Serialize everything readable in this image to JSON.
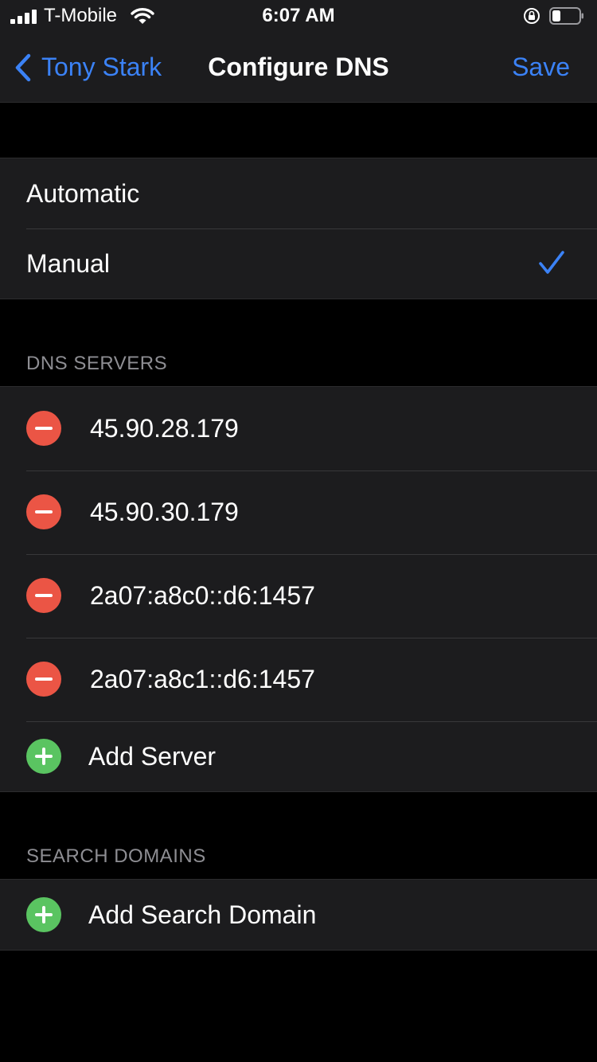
{
  "status_bar": {
    "carrier": "T-Mobile",
    "time": "6:07 AM",
    "icons": [
      "signal-icon",
      "wifi-icon",
      "rotation-lock-icon",
      "battery-icon"
    ]
  },
  "nav": {
    "back_label": "Tony Stark",
    "title": "Configure DNS",
    "save_label": "Save"
  },
  "dns_mode": {
    "options": [
      {
        "label": "Automatic",
        "selected": false
      },
      {
        "label": "Manual",
        "selected": true
      }
    ]
  },
  "dns_servers": {
    "header": "DNS SERVERS",
    "servers": [
      "45.90.28.179",
      "45.90.30.179",
      "2a07:a8c0::d6:1457",
      "2a07:a8c1::d6:1457"
    ],
    "add_label": "Add Server"
  },
  "search_domains": {
    "header": "SEARCH DOMAINS",
    "add_label": "Add Search Domain"
  },
  "colors": {
    "accent": "#3b82f6",
    "destructive": "#eb5545",
    "add": "#5ac461",
    "cell_background": "#1c1c1e",
    "page_background": "#000000"
  }
}
